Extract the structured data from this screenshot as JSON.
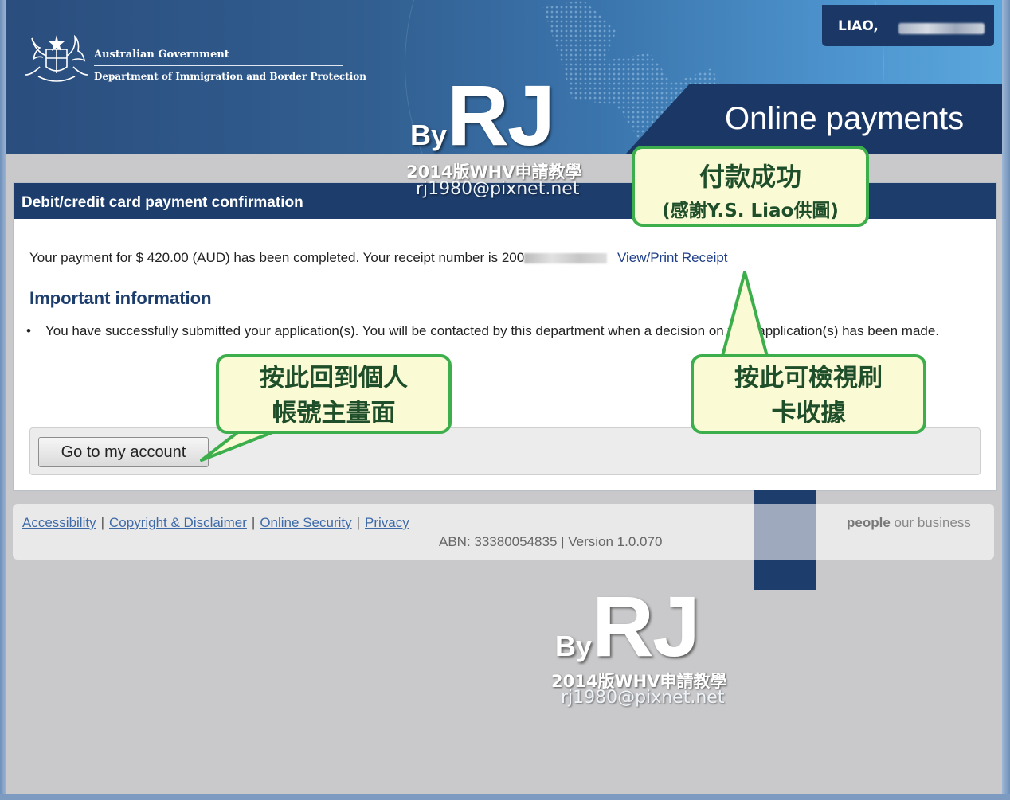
{
  "header": {
    "gov_line1": "Australian Government",
    "gov_line2": "Department of Immigration and Border Protection",
    "user_name": "LIAO,",
    "page_title": "Online payments"
  },
  "card": {
    "title": "Debit/credit card payment confirmation",
    "payment_text": "Your payment for $ 420.00 (AUD) has been completed. Your receipt number is 200",
    "receipt_link": "View/Print Receipt",
    "important_title": "Important information",
    "bullet_text": "You have successfully submitted your application(s). You will be contacted by this department when a decision on your application(s) has been made.",
    "button_label": "Go to my account"
  },
  "footer": {
    "links": [
      "Accessibility",
      "Copyright & Disclaimer",
      "Online Security",
      "Privacy"
    ],
    "abn": "ABN: 33380054835 | Version 1.0.070",
    "tagline_bold": "people",
    "tagline_rest": " our business"
  },
  "callouts": {
    "success_title": "付款成功",
    "success_sub": "(感謝Y.S. Liao供圖)",
    "go_account_line1": "按此回到個人",
    "go_account_line2": "帳號主畫面",
    "receipt_line1": "按此可檢視刷",
    "receipt_line2": "卡收據"
  },
  "watermark": {
    "by": "By",
    "rj": "RJ",
    "subtitle": "2014版WHV申請教學",
    "email": "rj1980@pixnet.net"
  },
  "colors": {
    "navy": "#1d3d6c",
    "callout_border": "#3cae4c",
    "callout_fill": "#fafad4",
    "link": "#1f3f8a"
  }
}
